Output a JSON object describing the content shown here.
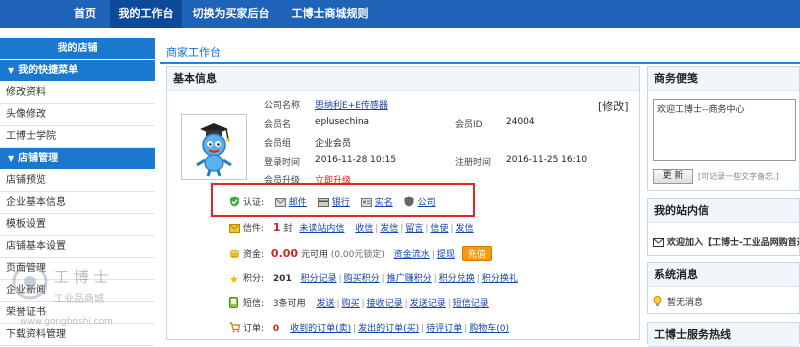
{
  "nav": {
    "tabs": [
      {
        "label": "首页"
      },
      {
        "label": "我的工作台"
      },
      {
        "label": "切换为买家后台"
      },
      {
        "label": "工博士商城规则"
      }
    ]
  },
  "sidebar": {
    "shop_header": "我的店铺",
    "quick_menu_header": "我的快捷菜单",
    "quick_items": [
      "修改资料",
      "头像修改",
      "工博士学院"
    ],
    "store_mgmt_header": "店铺管理",
    "store_items": [
      "店铺预览",
      "企业基本信息",
      "模板设置",
      "店铺基本设置",
      "页面管理",
      "企业新闻",
      "荣誉证书",
      "下载资料管理"
    ]
  },
  "main": {
    "breadcrumb": "商家工作台",
    "basic": {
      "title": "基本信息",
      "edit_link": "[修改]",
      "company_label": "公司名称",
      "company_value": "思纳利E+E传感器",
      "member_name_label": "会员名",
      "member_name_value": "eplusechina",
      "member_id_label": "会员ID",
      "member_id_value": "24004",
      "group_label": "会员组",
      "group_value": "企业会员",
      "login_label": "登录时间",
      "login_value": "2016-11-28 10:15",
      "reg_label": "注册时间",
      "reg_value": "2016-11-25 16:10",
      "upgrade_label": "会员升级",
      "upgrade_value": "立即升级",
      "cert": {
        "label": "认证:",
        "items": [
          "邮件",
          "银行",
          "实名",
          "公司"
        ]
      },
      "letters": {
        "label": "信件:",
        "count": "1",
        "unit": "封",
        "unread": "未读站内信",
        "links": [
          "收信",
          "发信",
          "留言",
          "信使",
          "发信"
        ]
      },
      "funds": {
        "label": "资金:",
        "amount": "0.00",
        "available": "元可用",
        "locked": "(0.00元锁定)",
        "links": [
          "资金流水",
          "提现"
        ],
        "button": "充值"
      },
      "points": {
        "label": "积分:",
        "count": "201",
        "links": [
          "积分记录",
          "购买积分",
          "推广赚积分",
          "积分兑换",
          "积分换礼"
        ]
      },
      "sms": {
        "label": "短信:",
        "count": "3条可用",
        "links": [
          "发送",
          "购买",
          "接收记录",
          "发送记录",
          "短信记录"
        ]
      },
      "orders": {
        "label": "订单:",
        "count": "0",
        "links": [
          "收到的订单(卖)",
          "发出的订单(买)",
          "待评订单",
          "购物车(0)"
        ]
      }
    },
    "memo": {
      "title": "商务便笺",
      "text": "欢迎工博士--商务中心",
      "button": "更  新",
      "hint": "[可记录一些文字备忘,]"
    },
    "inbox": {
      "title": "我的站内信",
      "item": "欢迎加入【工博士-工业品网购首选"
    },
    "sysmsg": {
      "title": "系统消息",
      "item": "暂无消息"
    },
    "hotline": {
      "title": "工博士服务热线"
    }
  },
  "colors": {
    "nav_bg": "#1e63b8",
    "sidebar_header": "#1b78cf",
    "alert_red": "#e02525",
    "money_red": "#d8221c",
    "link_blue": "#1344a8"
  }
}
